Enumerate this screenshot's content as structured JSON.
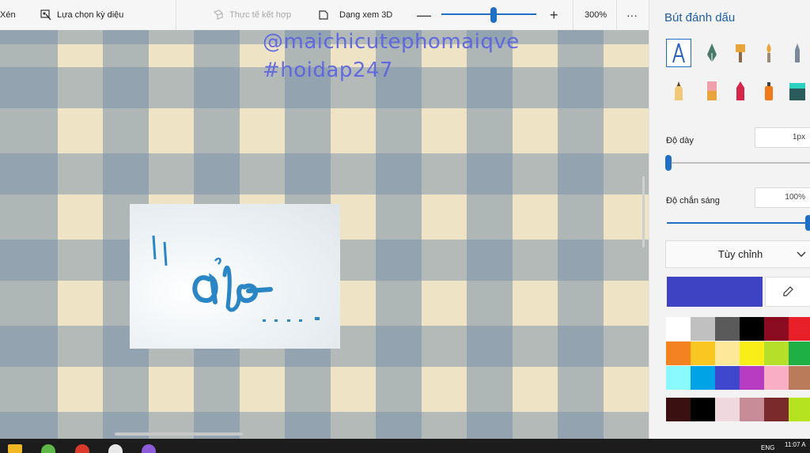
{
  "toolbar": {
    "crop_label": "Xén",
    "magic_select_label": "Lựa chọn kỳ diệu",
    "mixed_reality_label": "Thực tế kết hợp",
    "view_3d_label": "Dạng xem 3D",
    "zoom_minus": "—",
    "zoom_plus": "+",
    "zoom_level": "300%",
    "more_label": "···",
    "zoom_value_percent": 300,
    "icons": [
      "magic-select-icon",
      "mixed-reality-icon",
      "view-3d-icon",
      "more-icon"
    ]
  },
  "canvas": {
    "watermark_line1": "@maichicutephomaiqve",
    "watermark_line2": "#hoidap247",
    "watermark_color": "#5a62e0",
    "photo_text": "Hảo",
    "photo_text_prefix": "ıl",
    "photo_dots": ". . . .",
    "stroke_color": "#2a86c4"
  },
  "panel": {
    "title": "Bút đánh dấu",
    "brushes": [
      {
        "name": "calligraphy-pen",
        "selected": true
      },
      {
        "name": "fountain-pen",
        "selected": false
      },
      {
        "name": "oil-brush",
        "selected": false
      },
      {
        "name": "watercolor-brush",
        "selected": false
      },
      {
        "name": "pixel-pencil",
        "selected": false
      },
      {
        "name": "pencil",
        "selected": false
      },
      {
        "name": "eraser",
        "selected": false
      },
      {
        "name": "crayon",
        "selected": false
      },
      {
        "name": "spray-can",
        "selected": false
      },
      {
        "name": "fill-bucket",
        "selected": false
      }
    ],
    "thickness_label": "Độ dày",
    "thickness_value": "1px",
    "thickness_level": 0.0,
    "opacity_label": "Độ chắn sáng",
    "opacity_value": "100%",
    "opacity_level": 1.0,
    "color_mode": "Tùy chỉnh",
    "current_color": "#3e43c4",
    "palette": [
      "#ffffff",
      "#c0c0c0",
      "#5a5a5a",
      "#000000",
      "#8b0b21",
      "#e8202a",
      "#f58220",
      "#f9c622",
      "#fde89a",
      "#f9ee18",
      "#b6df2a",
      "#1fb045",
      "#8afaff",
      "#00a3e6",
      "#3f48cc",
      "#b83cc1",
      "#f9aec6",
      "#b97b5a"
    ],
    "palette_custom": [
      "#3a1010",
      "#000000",
      "#efd8de",
      "#c88b98",
      "#7a2a2a",
      "#b6e31f"
    ]
  },
  "taskbar": {
    "apps": [
      {
        "name": "file-explorer",
        "color": "#f2b823"
      },
      {
        "name": "green-app",
        "color": "#5fb848"
      },
      {
        "name": "chrome",
        "color": "#d93a2b"
      },
      {
        "name": "paint3d-app",
        "color": "#e8e8e8"
      },
      {
        "name": "cortana-app",
        "color": "#8d5bd8"
      }
    ],
    "language": "ENG",
    "time": "11:07 A"
  }
}
